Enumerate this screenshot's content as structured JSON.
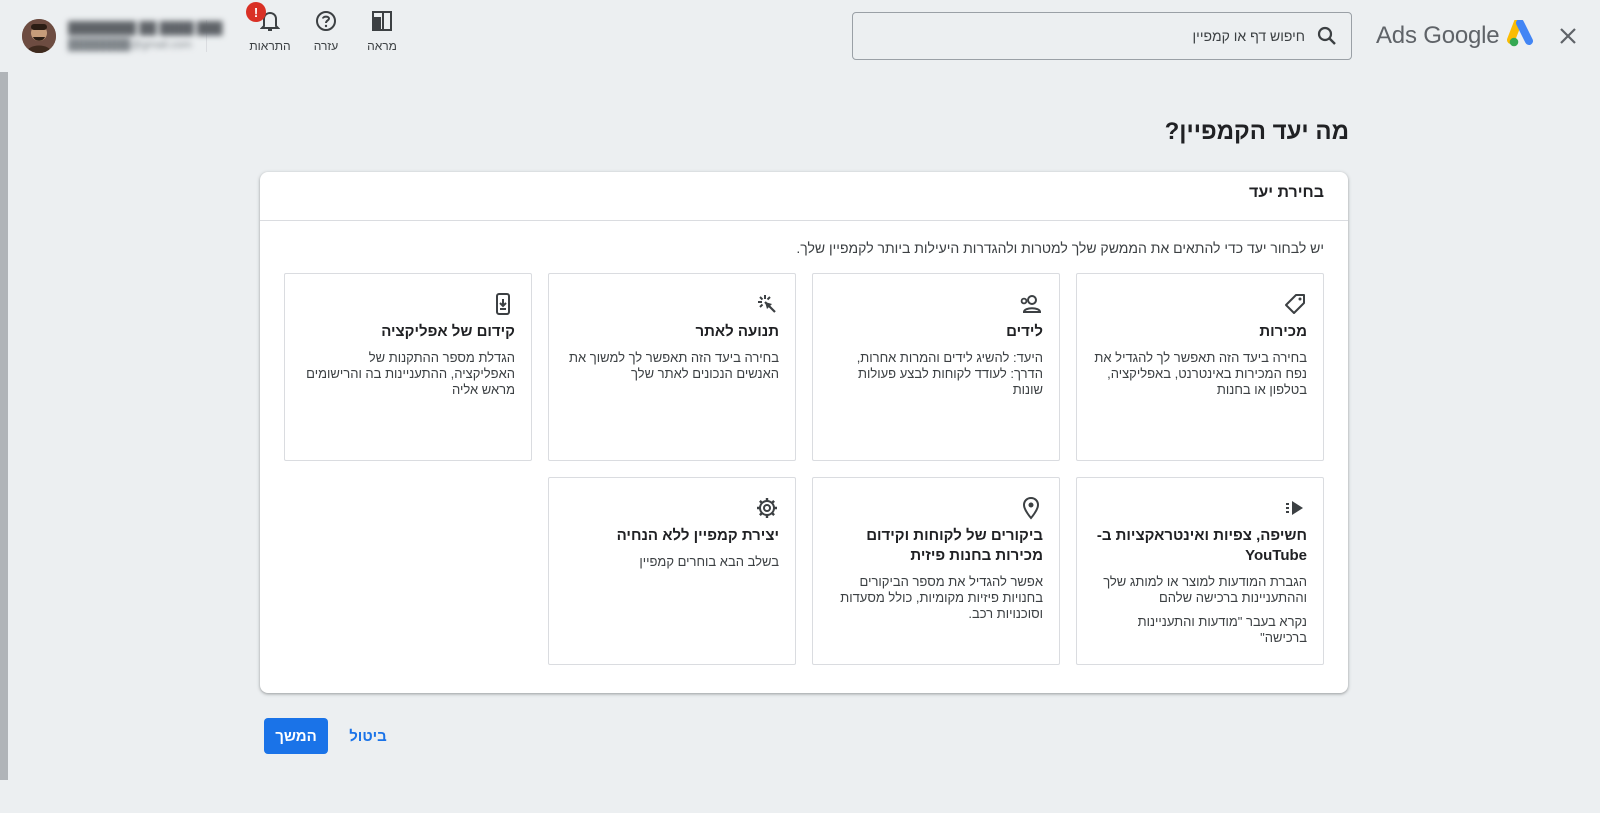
{
  "header": {
    "logo_text": "Ads Google",
    "search_placeholder": "חיפוש דף או קמפיין",
    "icons": [
      {
        "label": "מראה",
        "icon": "appearance-icon"
      },
      {
        "label": "עזרה",
        "icon": "help-icon"
      },
      {
        "label": "התראות",
        "icon": "bell-icon",
        "badge": "!"
      }
    ],
    "account": {
      "name": "████████ ██ ████ ███",
      "email": "████████@gmail.com"
    }
  },
  "main": {
    "page_title": "מה יעד הקמפיין?",
    "panel_title": "בחירת יעד",
    "panel_description": "יש לבחור יעד כדי להתאים את הממשק שלך למטרות ולהגדרות היעילות ביותר לקמפיין שלך.",
    "goals": [
      {
        "icon": "tag-icon",
        "title": "מכירות",
        "description": "בחירה ביעד הזה תאפשר לך להגדיל את נפח המכירות באינטרנט, באפליקציה, בטלפון או בחנות",
        "note": ""
      },
      {
        "icon": "leads-icon",
        "title": "לידים",
        "description": "היעד: להשיג לידים והמרות אחרות, הדרך: לעודד לקוחות לבצע פעולות שונות",
        "note": ""
      },
      {
        "icon": "cursor-click-icon",
        "title": "תנועה לאתר",
        "description": "בחירה ביעד הזה תאפשר לך למשוך את האנשים הנכונים לאתר שלך",
        "note": ""
      },
      {
        "icon": "mobile-download-icon",
        "title": "קידום של אפליקציה",
        "description": "הגדלת מספר ההתקנות של האפליקציה, ההתעניינות בה והרישומים מראש אליה",
        "note": ""
      },
      {
        "icon": "youtube-reach-icon",
        "title": "חשיפה, צפיות ואינטראקציות ב-YouTube",
        "description": "הגברת המודעות למוצר או למותג שלך וההתעניינות ברכישה שלהם",
        "note": "נקרא בעבר \"מודעות והתעניינות ברכישה\""
      },
      {
        "icon": "location-pin-icon",
        "title": "ביקורים של לקוחות וקידום מכירות בחנות פיזית",
        "description": "אפשר להגדיל את מספר הביקורים בחנויות פיזיות מקומיות, כולל מסעדות וסוכנויות רכב.",
        "note": ""
      },
      {
        "icon": "gear-icon",
        "title": "יצירת קמפיין ללא הנחיה",
        "description": "בשלב הבא בוחרים קמפיין",
        "note": ""
      }
    ]
  },
  "footer": {
    "continue_label": "המשך",
    "cancel_label": "ביטול"
  },
  "colors": {
    "accent": "#1a73e8",
    "background": "#eceff1",
    "badge": "#d93025"
  }
}
